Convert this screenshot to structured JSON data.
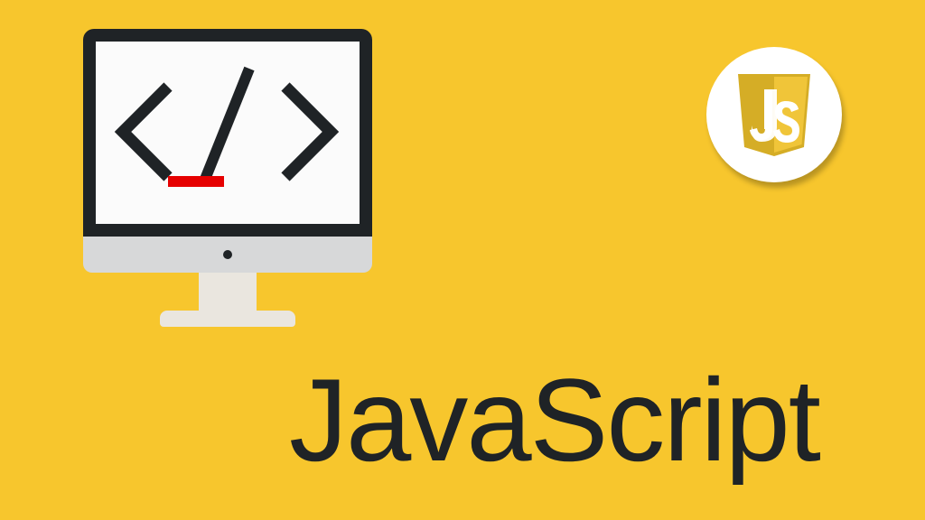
{
  "title": "JavaScript",
  "badge": {
    "letters": "JS"
  },
  "colors": {
    "background": "#f7c62d",
    "text": "#1f2326",
    "underline": "#e60000",
    "badgeShield": "#e8bc2a",
    "badgeCircle": "#ffffff",
    "monitorFrame": "#1f2326",
    "monitorChin": "#d7d8d9",
    "monitorStand": "#eae6df"
  }
}
